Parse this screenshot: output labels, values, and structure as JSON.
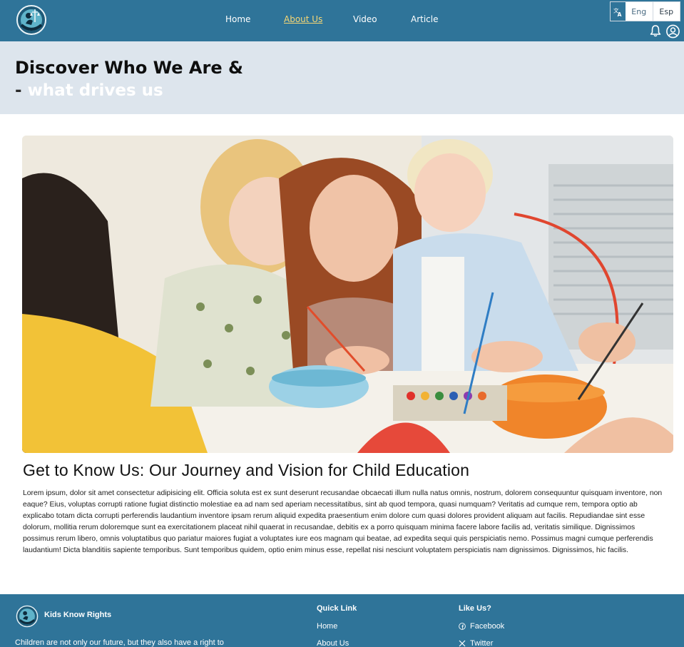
{
  "nav": {
    "items": [
      {
        "label": "Home",
        "active": false
      },
      {
        "label": "About Us",
        "active": true
      },
      {
        "label": "Video",
        "active": false
      },
      {
        "label": "Article",
        "active": false
      }
    ]
  },
  "language": {
    "icon": "translate-icon",
    "options": [
      "Eng",
      "Esp"
    ],
    "selected": "Eng"
  },
  "header_icons": [
    "bell-icon",
    "user-circle-icon"
  ],
  "hero": {
    "title": "Discover Who We Are &",
    "dash": "-",
    "subtitle": "what drives us"
  },
  "article": {
    "title": "Get to Know Us: Our Journey and Vision for Child Education",
    "body": "Lorem ipsum, dolor sit amet consectetur adipisicing elit. Officia soluta est ex sunt deserunt recusandae obcaecati illum nulla natus omnis, nostrum, dolorem consequuntur quisquam inventore, non eaque? Eius, voluptas corrupti ratione fugiat distinctio molestiae ea ad nam sed aperiam necessitatibus, sint ab quod tempora, quasi numquam? Veritatis ad cumque rem, tempora optio ab explicabo totam dicta corrupti perferendis laudantium inventore ipsam rerum aliquid expedita praesentium enim dolore cum quasi dolores provident aliquam aut facilis. Repudiandae sint esse dolorum, mollitia rerum doloremque sunt ea exercitationem placeat nihil quaerat in recusandae, debitis ex a porro quisquam minima facere labore facilis ad, veritatis similique. Dignissimos possimus rerum libero, omnis voluptatibus quo pariatur maiores fugiat a voluptates iure eos magnam qui beatae, ad expedita sequi quis perspiciatis nemo. Possimus magni cumque perferendis laudantium! Dicta blanditiis sapiente temporibus. Sunt temporibus quidem, optio enim minus esse, repellat nisi nesciunt voluptatem perspiciatis nam dignissimos. Dignissimos, hic facilis."
  },
  "footer": {
    "brand": "Kids Know Rights",
    "tagline": "Children are not only our future, but they also have a right to",
    "quick_link": {
      "heading": "Quick Link",
      "links": [
        "Home",
        "About Us"
      ]
    },
    "like_us": {
      "heading": "Like Us?",
      "links": [
        {
          "label": "Facebook",
          "icon": "facebook-icon"
        },
        {
          "label": "Twitter",
          "icon": "x-twitter-icon"
        }
      ]
    }
  },
  "colors": {
    "primary": "#2f7499",
    "band": "#dde5ed",
    "active_nav": "#f7d774"
  }
}
